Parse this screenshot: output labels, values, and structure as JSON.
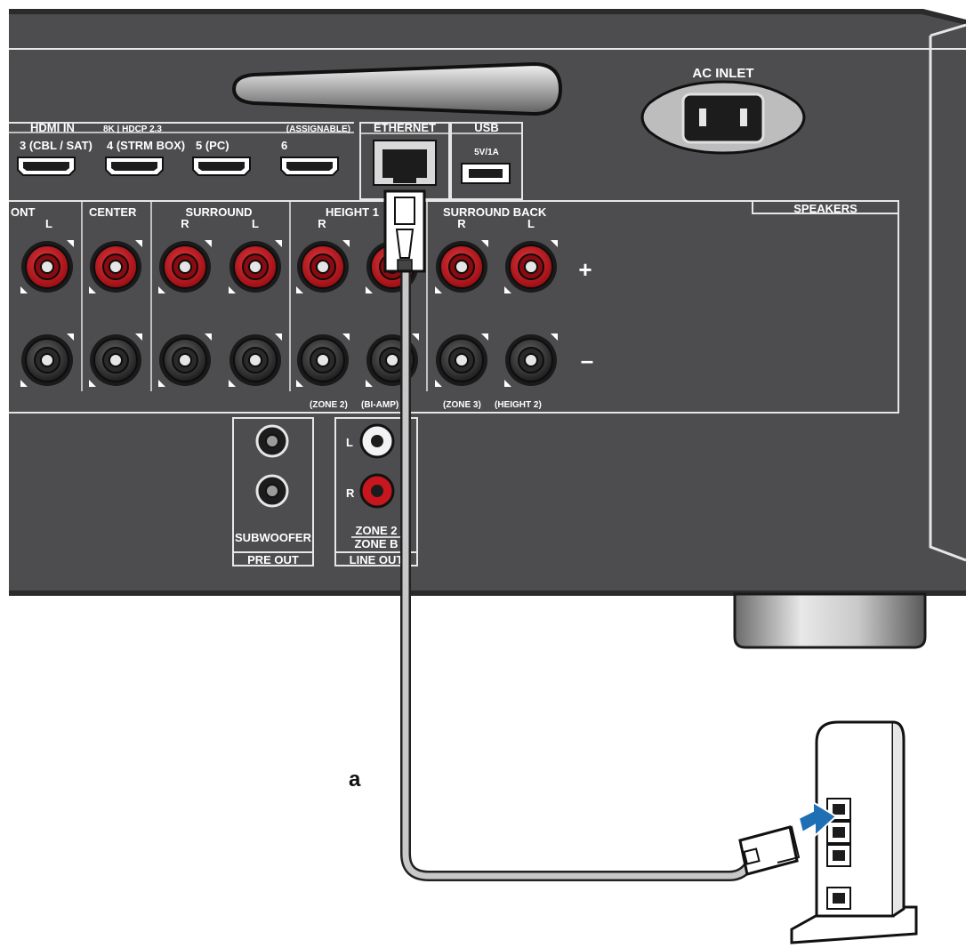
{
  "receiver": {
    "ac_inlet": "AC INLET",
    "hdmi": {
      "title": "HDMI IN",
      "spec": "8K | HDCP 2.3",
      "assignable": "(ASSIGNABLE)",
      "ports": [
        {
          "label": "3 (CBL / SAT)"
        },
        {
          "label": "4 (STRM BOX)"
        },
        {
          "label": "5 (PC)"
        },
        {
          "label": "6"
        }
      ]
    },
    "ethernet": "ETHERNET",
    "usb": {
      "title": "USB",
      "rating": "5V/1A"
    },
    "speakers": {
      "title": "SPEAKERS",
      "groups": {
        "front": "ONT",
        "center": "CENTER",
        "surround": "SURROUND",
        "height": "HEIGHT 1",
        "surround_back": "SURROUND BACK"
      },
      "channels": {
        "front_l": "L",
        "surround_r": "R",
        "surround_l": "L",
        "height_r": "R",
        "surround_back_r": "R",
        "surround_back_l": "L"
      },
      "plus": "+",
      "minus": "–",
      "footnote_zone2": "(ZONE 2)",
      "footnote_biamp": "(BI-AMP)",
      "footnote_zone3": "(ZONE 3)",
      "footnote_height2": "(HEIGHT 2)"
    },
    "pre_out": {
      "subwoofer": "SUBWOOFER",
      "title": "PRE OUT"
    },
    "line_out": {
      "l": "L",
      "r": "R",
      "zone2": "ZONE 2",
      "zoneb": "ZONE B",
      "title": "LINE OUT"
    }
  },
  "callout": "a",
  "colors": {
    "panel": "#4d4d4f",
    "panel_edge": "#2b2b2c",
    "binding_red": "#c8161e",
    "arrow_blue": "#1f6fb5",
    "cable": "#c8c8c8"
  }
}
